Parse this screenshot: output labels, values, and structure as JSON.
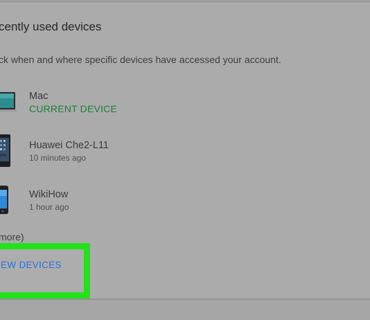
{
  "section": {
    "title": "cently used devices",
    "subtitle": "ck when and where specific devices have accessed your account."
  },
  "devices": [
    {
      "name": "Mac",
      "meta": "CURRENT DEVICE",
      "icon": "laptop-icon"
    },
    {
      "name": "Huawei Che2-L11",
      "meta": "10 minutes ago",
      "icon": "android-phone-icon"
    },
    {
      "name": "WikiHow",
      "meta": "1 hour ago",
      "icon": "iphone-icon"
    }
  ],
  "more_text": "more)",
  "review_button_label": "IEW DEVICES",
  "colors": {
    "current_device": "#1b7f3a",
    "button_text": "#2e6fd8",
    "highlight_border": "#22e21a"
  }
}
